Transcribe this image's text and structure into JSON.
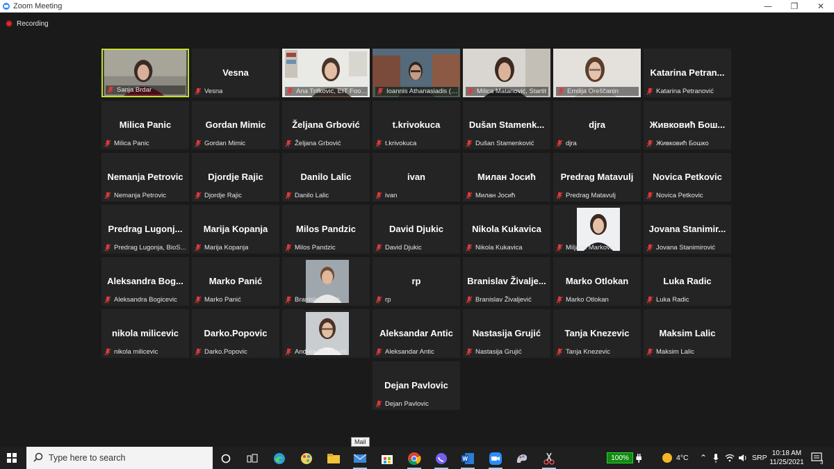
{
  "window": {
    "title": "Zoom Meeting",
    "minimize": "—",
    "restore": "❐",
    "close": "✕"
  },
  "recording": {
    "label": "Recording"
  },
  "participants": [
    {
      "display": "",
      "label": "Sanja Brdar",
      "video": true,
      "active": true
    },
    {
      "display": "Vesna",
      "label": "Vesna"
    },
    {
      "display": "",
      "label": "Ana Trifković, EIT Food ...",
      "video": true
    },
    {
      "display": "",
      "label": "Ioannis Athanasiadis (WU...",
      "video": true
    },
    {
      "display": "",
      "label": "Milica Matanović, Startit",
      "video": true
    },
    {
      "display": "",
      "label": "Emilija Oreščanin",
      "video": true
    },
    {
      "display": "Katarina Petran...",
      "label": "Katarina Petranović"
    },
    {
      "display": "Milica Panic",
      "label": "Milica Panic"
    },
    {
      "display": "Gordan Mimic",
      "label": "Gordan Mimic"
    },
    {
      "display": "Željana Grbović",
      "label": "Željana Grbović"
    },
    {
      "display": "t.krivokuca",
      "label": "t.krivokuca"
    },
    {
      "display": "Dušan Stamenk...",
      "label": "Dušan Stamenković"
    },
    {
      "display": "djra",
      "label": "djra"
    },
    {
      "display": "Живковић Бош...",
      "label": "Живковић Бошко"
    },
    {
      "display": "Nemanja Petrovic",
      "label": "Nemanja Petrovic"
    },
    {
      "display": "Djordje Rajic",
      "label": "Djordje Rajic"
    },
    {
      "display": "Danilo Lalic",
      "label": "Danilo Lalic"
    },
    {
      "display": "ivan",
      "label": "ivan"
    },
    {
      "display": "Милан Јосић",
      "label": "Милан Јосић"
    },
    {
      "display": "Predrag Matavulj",
      "label": "Predrag Matavulj"
    },
    {
      "display": "Novica Petkovic",
      "label": "Novica Petkovic"
    },
    {
      "display": "Predrag Lugonj...",
      "label": "Predrag Lugonja, BioS..."
    },
    {
      "display": "Marija Kopanja",
      "label": "Marija Kopanja"
    },
    {
      "display": "Milos Pandzic",
      "label": "Milos Pandzic"
    },
    {
      "display": "David Djukic",
      "label": "David Djukic"
    },
    {
      "display": "Nikola Kukavica",
      "label": "Nikola Kukavica"
    },
    {
      "display": "",
      "label": "Miljana Marković",
      "photo": true
    },
    {
      "display": "Jovana Stanimir...",
      "label": "Jovana Stanimirović"
    },
    {
      "display": "Aleksandra Bog...",
      "label": "Aleksandra Bogicevic"
    },
    {
      "display": "Marko Panić",
      "label": "Marko Panić"
    },
    {
      "display": "",
      "label": "Branislav Pejak",
      "photo": true
    },
    {
      "display": "rp",
      "label": "rp"
    },
    {
      "display": "Branislav Živalje...",
      "label": "Branislav Živaljević"
    },
    {
      "display": "Marko Otlokan",
      "label": "Marko Otlokan"
    },
    {
      "display": "Luka Radic",
      "label": "Luka Radic"
    },
    {
      "display": "nikola milicevic",
      "label": "nikola milicevic"
    },
    {
      "display": "Darko.Popovic",
      "label": "Darko.Popovic"
    },
    {
      "display": "",
      "label": "Andrea Mihajlović",
      "photo": true
    },
    {
      "display": "Aleksandar Antic",
      "label": "Aleksandar Antic"
    },
    {
      "display": "Nastasija Grujić",
      "label": "Nastasija Grujić"
    },
    {
      "display": "Tanja Knezevic",
      "label": "Tanja Knezevic"
    },
    {
      "display": "Maksim Lalic",
      "label": "Maksim Lalic"
    },
    {
      "display": "Dejan Pavlovic",
      "label": "Dejan Pavlovic"
    }
  ],
  "tooltip": {
    "text": "Mail"
  },
  "taskbar": {
    "search_placeholder": "Type here to search",
    "battery": "100%",
    "weather": "4°C",
    "language": "SRP",
    "time": "10:18 AM",
    "date": "11/25/2021",
    "notification_count": "3"
  },
  "colors": {
    "accent_border": "#c6e035",
    "muted_mic": "#e03a3a",
    "tile_bg": "#242424"
  }
}
